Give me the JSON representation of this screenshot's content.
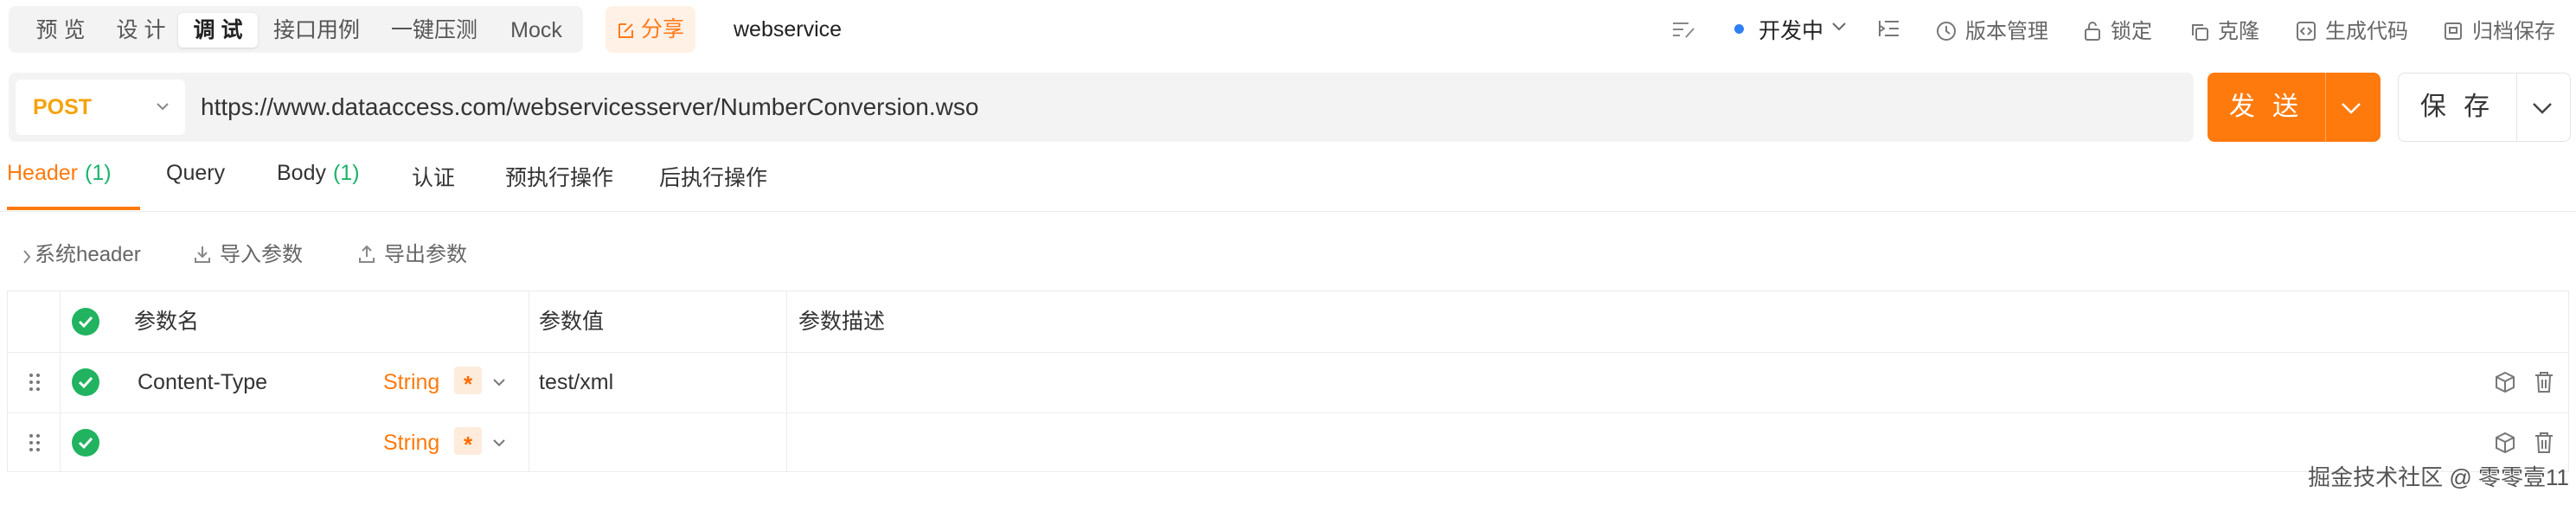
{
  "mode_tabs": [
    "预 览",
    "设 计",
    "调 试",
    "接口用例",
    "一键压测",
    "Mock"
  ],
  "share": {
    "label": "分享"
  },
  "api": {
    "name": "webservice"
  },
  "status": {
    "label": "开发中",
    "color": "#2f7ff5"
  },
  "tools": {
    "version": "版本管理",
    "lock": "锁定",
    "clone": "克隆",
    "gencode": "生成代码",
    "archive": "归档保存"
  },
  "request": {
    "method": "POST",
    "method_color": "#f5a20a",
    "url": "https://www.dataaccess.com/webservicesserver/NumberConversion.wso",
    "send_label": "发 送",
    "save_label": "保 存",
    "accent": "#ff7a0d"
  },
  "req_tabs": {
    "header": {
      "label": "Header",
      "count": "(1)"
    },
    "query": {
      "label": "Query"
    },
    "body": {
      "label": "Body",
      "count": "(1)"
    },
    "auth": {
      "label": "认证"
    },
    "pre": {
      "label": "预执行操作"
    },
    "post": {
      "label": "后执行操作"
    }
  },
  "subbar": {
    "system_header": "系统header",
    "import": "导入参数",
    "export": "导出参数"
  },
  "table": {
    "columns": [
      "参数名",
      "参数值",
      "参数描述"
    ],
    "rows": [
      {
        "name": "Content-Type",
        "type": "String",
        "required": "*",
        "value": "test/xml",
        "desc": ""
      },
      {
        "name": "",
        "type": "String",
        "required": "*",
        "value": "",
        "desc": ""
      }
    ]
  },
  "watermark": "掘金技术社区 @ 零零壹11"
}
